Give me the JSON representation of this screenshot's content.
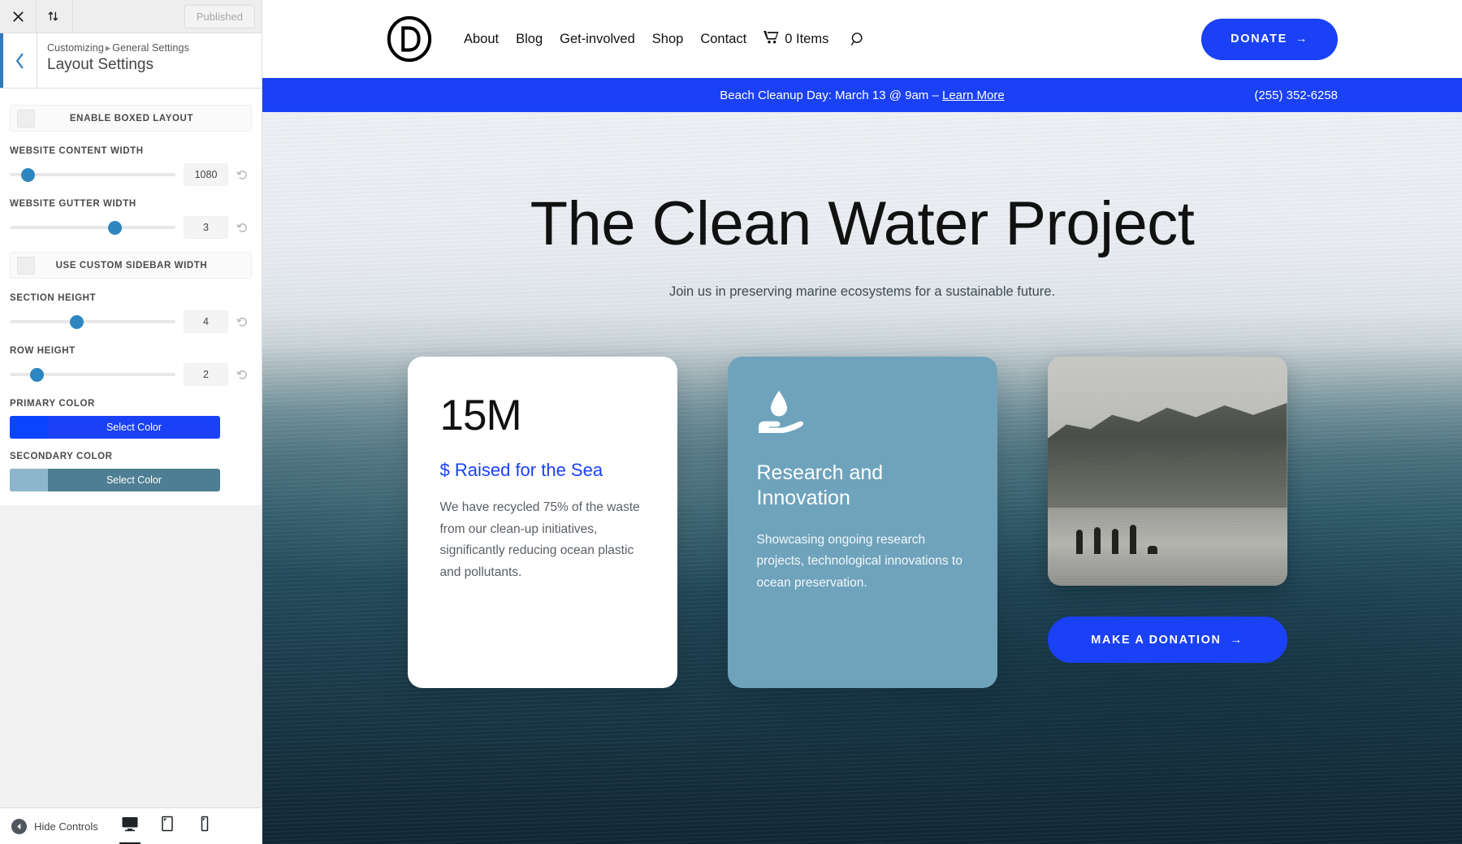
{
  "customizer": {
    "topbar": {
      "close_icon": "close-icon",
      "devices_icon": "collapse-icon",
      "publish_label": "Published"
    },
    "header": {
      "back_icon": "chevron-left-icon",
      "breadcrumb_root": "Customizing",
      "breadcrumb_sep": "▸",
      "breadcrumb_section": "General Settings",
      "panel_title": "Layout Settings"
    },
    "controls": {
      "enable_boxed_layout": "ENABLE BOXED LAYOUT",
      "website_content_width_label": "WEBSITE CONTENT WIDTH",
      "website_content_width_value": "1080",
      "website_content_width_percent": 11,
      "website_gutter_width_label": "WEBSITE GUTTER WIDTH",
      "website_gutter_width_value": "3",
      "website_gutter_width_percent": 63,
      "use_custom_sidebar_width": "USE CUSTOM SIDEBAR WIDTH",
      "section_height_label": "SECTION HEIGHT",
      "section_height_value": "4",
      "section_height_percent": 40,
      "row_height_label": "ROW HEIGHT",
      "row_height_value": "2",
      "row_height_percent": 16,
      "primary_color_label": "PRIMARY COLOR",
      "primary_color_button": "Select Color",
      "primary_color_hex": "#1a41f5",
      "primary_color_swatch_hex": "#0b44ff",
      "secondary_color_label": "SECONDARY COLOR",
      "secondary_color_button": "Select Color",
      "secondary_color_hex": "#4e7e93",
      "secondary_color_swatch_hex": "#8cb6cb"
    },
    "bottombar": {
      "hide_controls": "Hide Controls",
      "desktop_icon": "desktop-icon",
      "tablet_icon": "tablet-icon",
      "mobile_icon": "mobile-icon"
    }
  },
  "site": {
    "logo_letter": "D",
    "nav": [
      {
        "label": "About"
      },
      {
        "label": "Blog"
      },
      {
        "label": "Get-involved"
      },
      {
        "label": "Shop"
      },
      {
        "label": "Contact"
      }
    ],
    "cart_label": "0 Items",
    "cart_icon": "shopping-cart-icon",
    "search_icon": "search-icon",
    "donate_label": "DONATE",
    "donate_arrow": "→",
    "announcement": {
      "text": "Beach Cleanup Day: March 13 @ 9am – ",
      "link": "Learn More",
      "phone": "(255) 352-6258"
    },
    "hero": {
      "title": "The Clean Water Project",
      "subtitle": "Join us in preserving marine ecosystems for a sustainable future."
    },
    "cards": [
      {
        "type": "stat",
        "number": "15M",
        "label": "$ Raised for the Sea",
        "body": "We have recycled 75% of the waste from our clean-up initiatives, significantly reducing ocean plastic and pollutants."
      },
      {
        "type": "feature",
        "icon": "water-drop-in-hand-icon",
        "title": "Research and Innovation",
        "body": "Showcasing ongoing research projects, technological innovations to ocean preservation."
      },
      {
        "type": "photo",
        "image_alt": "beach-photo",
        "button_label": "MAKE A DONATION",
        "button_arrow": "→"
      }
    ]
  }
}
